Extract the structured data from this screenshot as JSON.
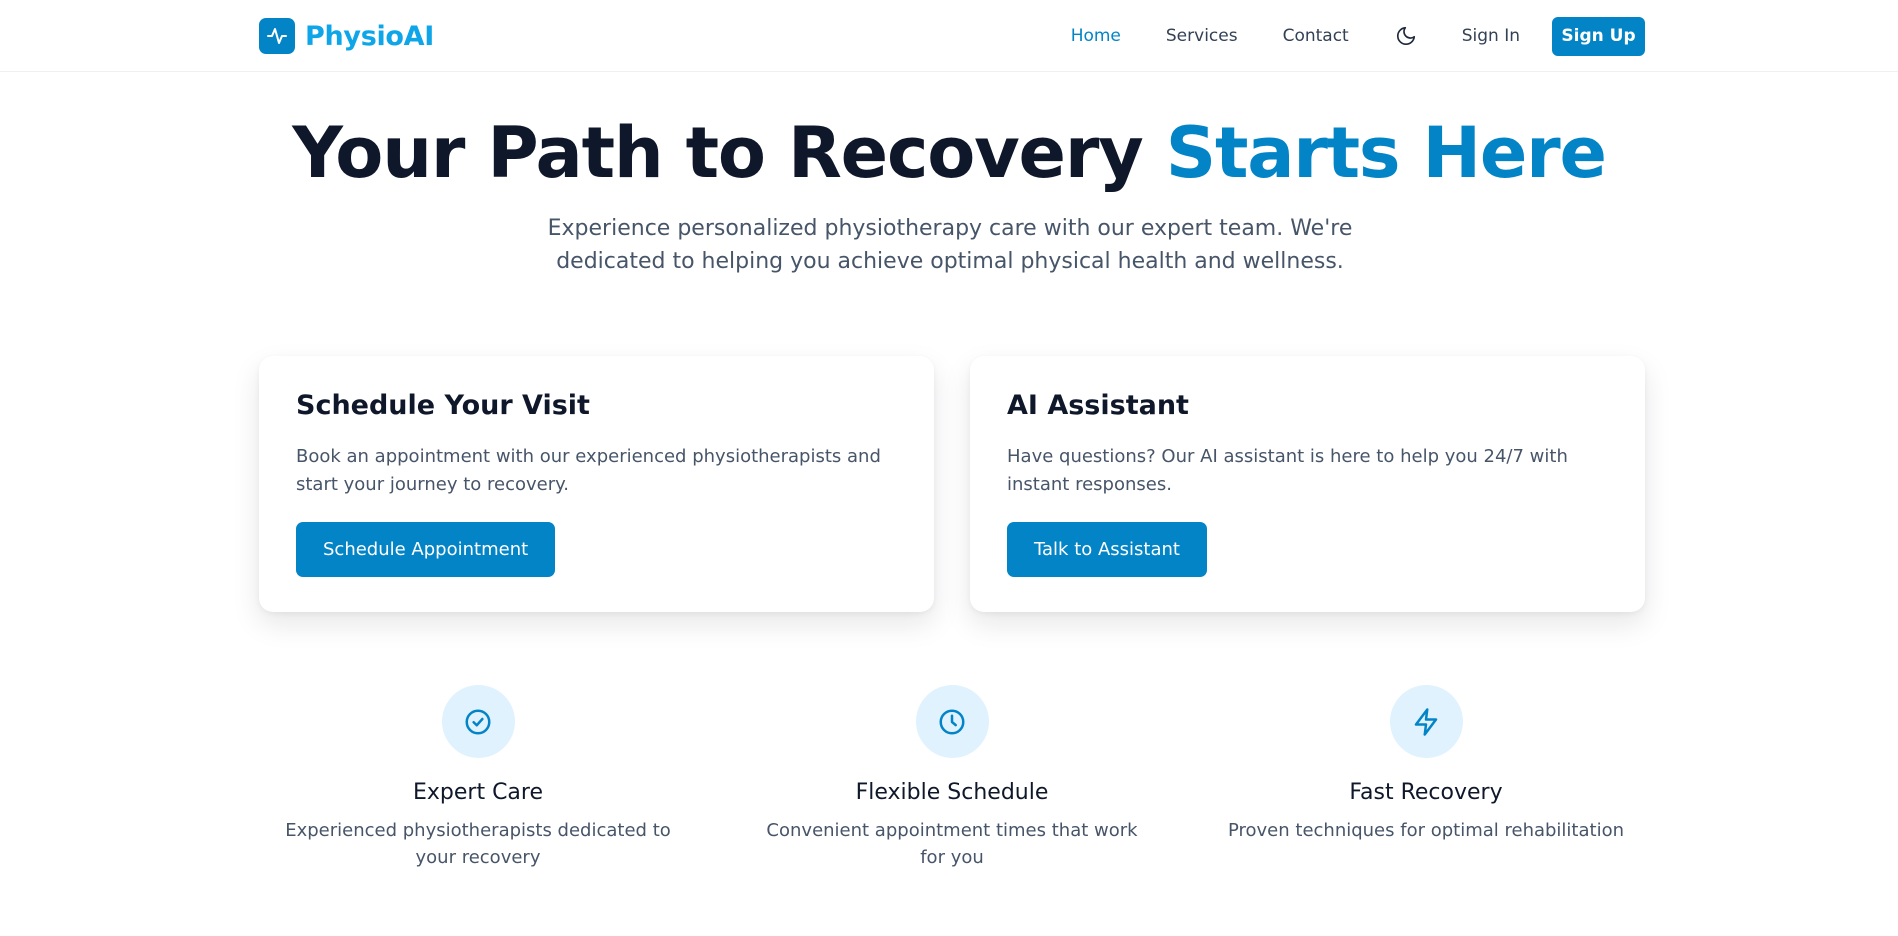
{
  "brand": {
    "name": "PhysioAI",
    "icon": "activity-icon",
    "color": "#0284c7"
  },
  "nav": {
    "links": [
      {
        "label": "Home",
        "active": true
      },
      {
        "label": "Services",
        "active": false
      },
      {
        "label": "Contact",
        "active": false
      }
    ],
    "theme_toggle_icon": "moon-icon",
    "sign_in": "Sign In",
    "sign_up": "Sign Up"
  },
  "hero": {
    "title_main": "Your Path to Recovery ",
    "title_accent": "Starts Here",
    "subtitle": "Experience personalized physiotherapy care with our expert team. We're dedicated to helping you achieve optimal physical health and wellness."
  },
  "cards": [
    {
      "title": "Schedule Your Visit",
      "text": "Book an appointment with our experienced physiotherapists and start your journey to recovery.",
      "button": "Schedule Appointment"
    },
    {
      "title": "AI Assistant",
      "text": "Have questions? Our AI assistant is here to help you 24/7 with instant responses.",
      "button": "Talk to Assistant"
    }
  ],
  "features": [
    {
      "icon": "check-circle-icon",
      "title": "Expert Care",
      "text": "Experienced physiotherapists dedicated to your recovery"
    },
    {
      "icon": "clock-icon",
      "title": "Flexible Schedule",
      "text": "Convenient appointment times that work for you"
    },
    {
      "icon": "lightning-icon",
      "title": "Fast Recovery",
      "text": "Proven techniques for optimal rehabilitation"
    }
  ],
  "colors": {
    "accent": "#0284c7",
    "accent_light": "#e0f2fe",
    "heading": "#0f172a",
    "body": "#475569"
  }
}
